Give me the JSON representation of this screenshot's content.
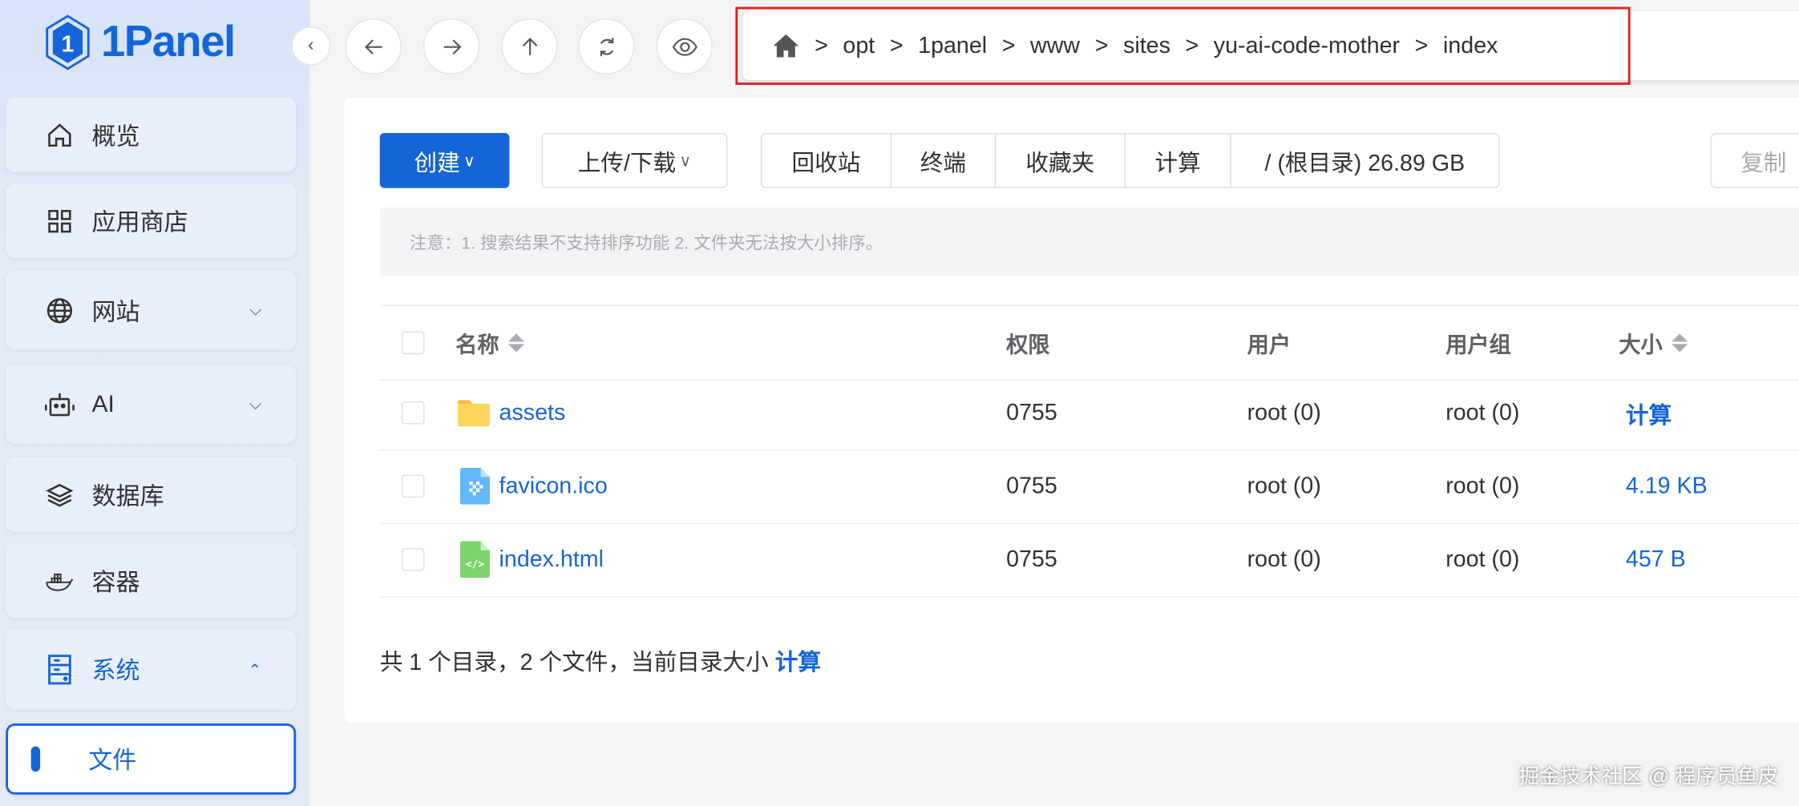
{
  "app": {
    "logo_text": "1Panel"
  },
  "sidebar": {
    "items": [
      {
        "label": "概览",
        "icon": "home-icon"
      },
      {
        "label": "应用商店",
        "icon": "grid-icon"
      },
      {
        "label": "网站",
        "icon": "globe-icon"
      },
      {
        "label": "AI",
        "icon": "robot-icon"
      },
      {
        "label": "数据库",
        "icon": "layers-icon"
      },
      {
        "label": "容器",
        "icon": "docker-icon"
      },
      {
        "label": "系统",
        "icon": "server-icon"
      },
      {
        "label": "文件"
      }
    ]
  },
  "breadcrumb": [
    "opt",
    "1panel",
    "www",
    "sites",
    "yu-ai-code-mother",
    "index"
  ],
  "breadcrumb_sep": ">",
  "toolbar": {
    "create": "创建",
    "upload": "上传/下载",
    "recycle": "回收站",
    "terminal": "终端",
    "favorites": "收藏夹",
    "calc": "计算",
    "root": "/ (根目录) 26.89 GB",
    "copy": "复制"
  },
  "notice": "注意：1. 搜索结果不支持排序功能 2. 文件夹无法按大小排序。",
  "table": {
    "headers": {
      "name": "名称",
      "perm": "权限",
      "user": "用户",
      "group": "用户组",
      "size": "大小"
    },
    "rows": [
      {
        "name": "assets",
        "type": "folder",
        "perm": "0755",
        "user": "root (0)",
        "group": "root (0)",
        "size": "计算"
      },
      {
        "name": "favicon.ico",
        "type": "image",
        "perm": "0755",
        "user": "root (0)",
        "group": "root (0)",
        "size": "4.19 KB"
      },
      {
        "name": "index.html",
        "type": "html",
        "perm": "0755",
        "user": "root (0)",
        "group": "root (0)",
        "size": "457 B"
      }
    ]
  },
  "summary": {
    "text": "共 1 个目录，2 个文件，当前目录大小 ",
    "link": "计算"
  },
  "watermark": "掘金技术社区 @ 程序员鱼皮",
  "colors": {
    "primary": "#1565d8",
    "highlight": "#e02020"
  }
}
